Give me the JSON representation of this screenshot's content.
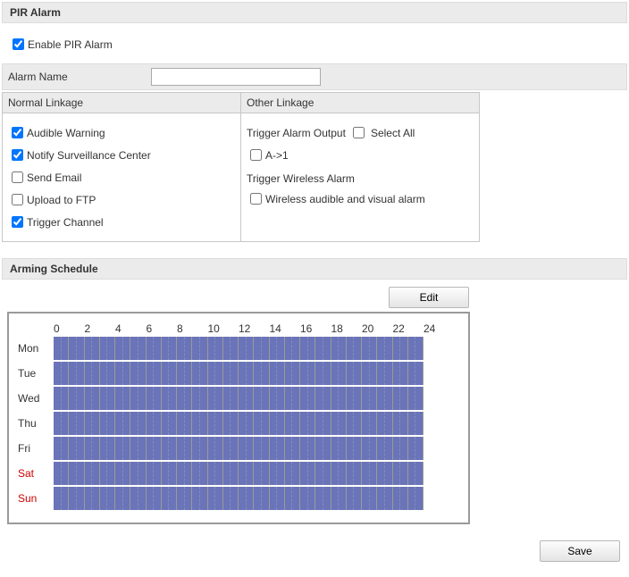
{
  "pir": {
    "header": "PIR Alarm",
    "enable_label": "Enable PIR Alarm",
    "enable_checked": true,
    "alarm_name_label": "Alarm Name",
    "alarm_name_value": ""
  },
  "linkage": {
    "normal_header": "Normal Linkage",
    "other_header": "Other Linkage",
    "normal": [
      {
        "label": "Audible Warning",
        "checked": true
      },
      {
        "label": "Notify Surveillance Center",
        "checked": true
      },
      {
        "label": "Send Email",
        "checked": false
      },
      {
        "label": "Upload to FTP",
        "checked": false
      },
      {
        "label": "Trigger Channel",
        "checked": true
      }
    ],
    "other": {
      "trigger_output_label": "Trigger Alarm Output",
      "select_all_label": "Select All",
      "select_all_checked": false,
      "a1_label": "A->1",
      "a1_checked": false,
      "wireless_header": "Trigger Wireless Alarm",
      "wireless_item_label": "Wireless audible and visual alarm",
      "wireless_item_checked": false
    }
  },
  "schedule": {
    "header": "Arming Schedule",
    "edit_label": "Edit",
    "hours": [
      "0",
      "2",
      "4",
      "6",
      "8",
      "10",
      "12",
      "14",
      "16",
      "18",
      "20",
      "22",
      "24"
    ],
    "days": [
      {
        "label": "Mon",
        "weekend": false
      },
      {
        "label": "Tue",
        "weekend": false
      },
      {
        "label": "Wed",
        "weekend": false
      },
      {
        "label": "Thu",
        "weekend": false
      },
      {
        "label": "Fri",
        "weekend": false
      },
      {
        "label": "Sat",
        "weekend": true
      },
      {
        "label": "Sun",
        "weekend": true
      }
    ]
  },
  "buttons": {
    "save": "Save"
  }
}
